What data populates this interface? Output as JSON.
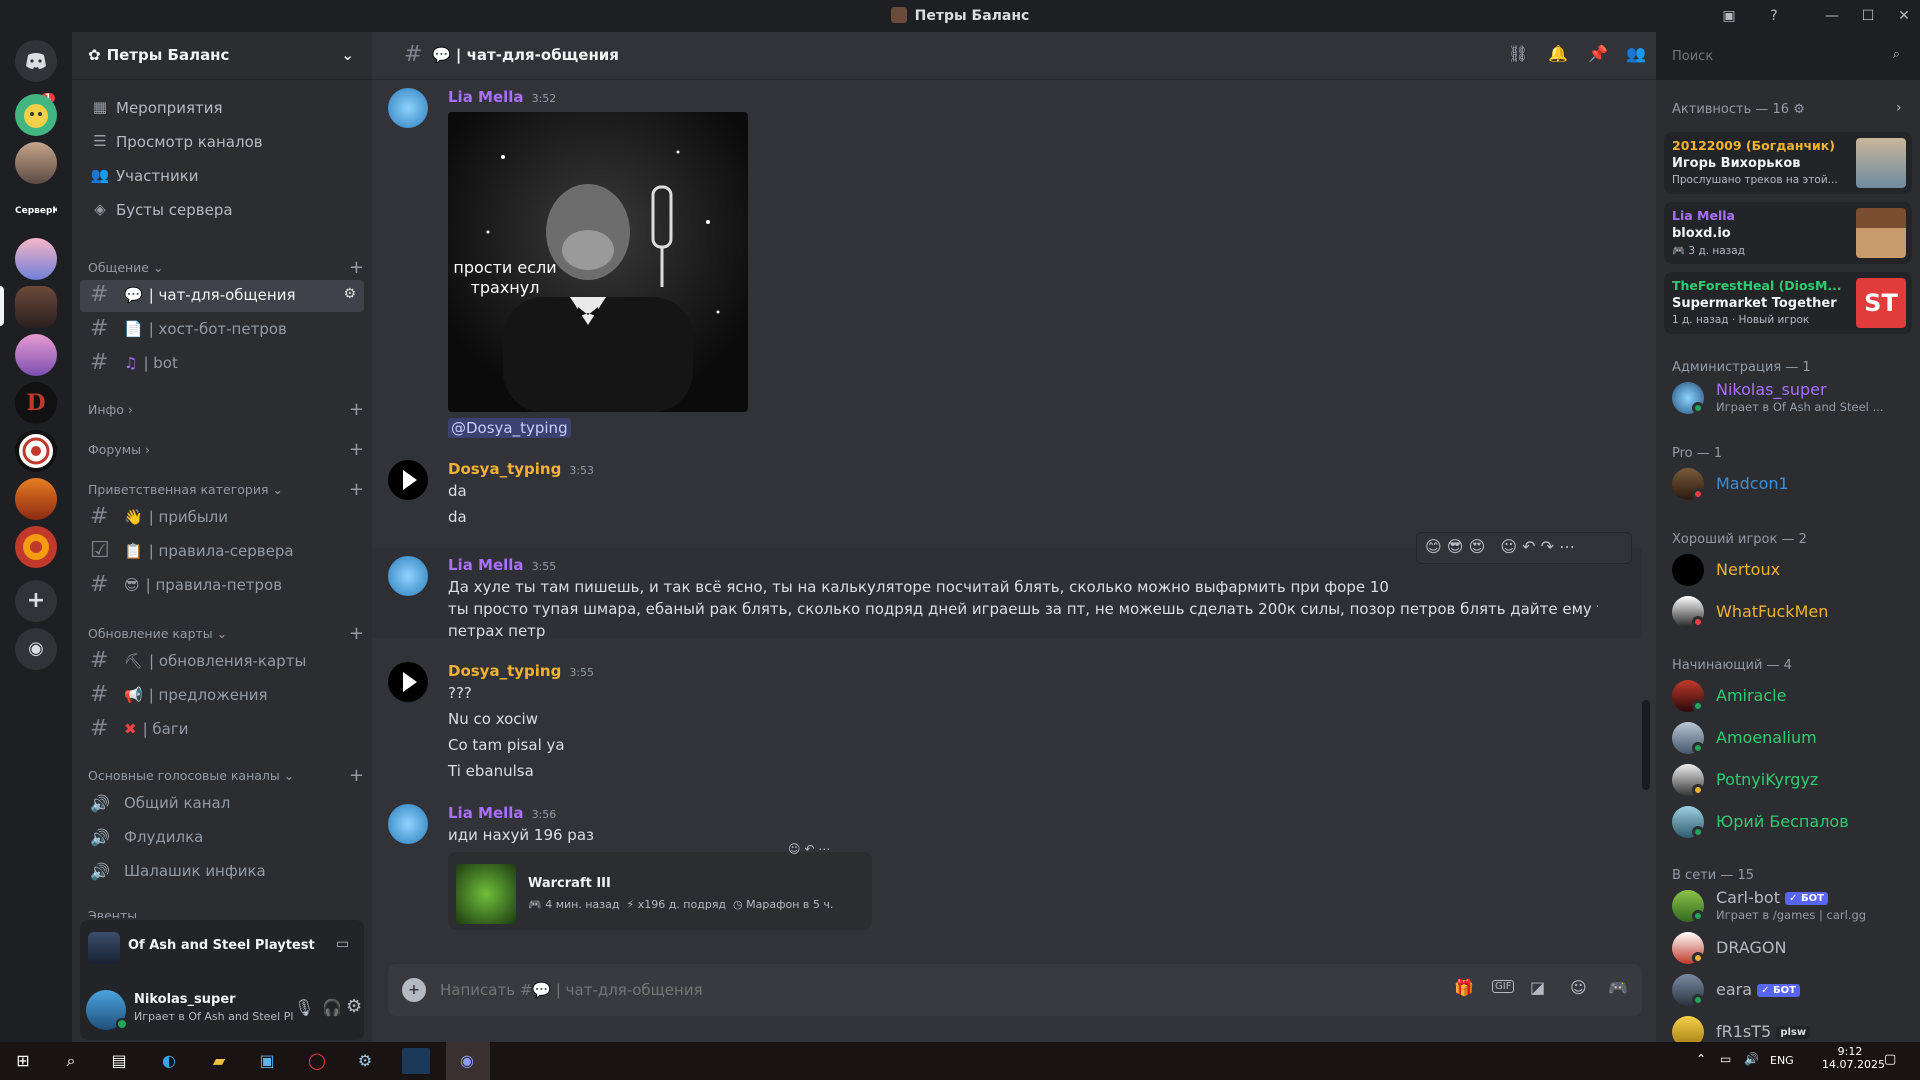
{
  "window": {
    "title": "Петры Баланс"
  },
  "guild": {
    "name": "Петры Баланс",
    "nav": [
      "Мероприятия",
      "Просмотр каналов",
      "Участники",
      "Бусты сервера"
    ],
    "categories": {
      "c1": "Общение",
      "c2": "Инфо",
      "c3": "Форумы",
      "c4": "Приветственная категория",
      "c5": "Обновление карты",
      "c6": "Основные голосовые каналы",
      "c7": "Эвенты"
    },
    "channels": {
      "chat": "| чат-для-общения",
      "host": "| хост-бот-петров",
      "bot": "| bot",
      "pribyli": "| прибыли",
      "rules_server": "| правила-сервера",
      "rules_petr": "| правила-петров",
      "map_updates": "| обновления-карты",
      "suggestions": "| предложения",
      "bugs": "| баги"
    },
    "voice": [
      "Общий канал",
      "Флудилка",
      "Шалашик инфика"
    ],
    "server_badge": "1",
    "server_label": "СерверК"
  },
  "activity_card": {
    "title": "Of Ash and Steel Playtest"
  },
  "user_panel": {
    "name": "Nikolas_super",
    "status": "Играет в Of Ash and Steel Pla..."
  },
  "chat_header": {
    "channel": "| чат-для-общения",
    "search_placeholder": "Поиск"
  },
  "messages": {
    "m1": {
      "author": "Lia Mella",
      "time": "3:52",
      "image_caption_l1": "прости если",
      "image_caption_l2": "трахнул",
      "mention": "@Dosya_typing"
    },
    "m2": {
      "author": "Dosya_typing",
      "time": "3:53",
      "l1": "da",
      "l2": "da"
    },
    "m3": {
      "author": "Lia Mella",
      "time": "3:55",
      "l1": "Да хуле ты там пишешь, и так всё ясно, ты на калькуляторе посчитай блять, сколько можно выфармить при форе 10",
      "l2": "ты просто тупая шмара, ебаный рак блять, сколько подряд дней играешь за пт, не можешь сделать 200к силы, позор петров блять дайте ему тег нахуй позорный в",
      "l3": "петрах петр"
    },
    "m4": {
      "author": "Dosya_typing",
      "time": "3:55",
      "l1": "???",
      "l2": "Nu co xociw",
      "l3": "Co tam pisal ya",
      "l4": "Ti ebanulsa"
    },
    "m5": {
      "author": "Lia Mella",
      "time": "3:56",
      "l1": "иди нахуй 196 раз",
      "embed_title": "Warcraft III",
      "embed_a": "4 мин. назад",
      "embed_b": "x196 д. подряд",
      "embed_c": "Марафон в 5 ч."
    }
  },
  "composer": {
    "placeholder": "Написать #💬 | чат-для-общения"
  },
  "members": {
    "activity_header": "Активность — 16",
    "activities": [
      {
        "user": "20122009 (Богданчик)",
        "title": "Игорь Вихорьков",
        "sub": "Прослушано треков на этой...",
        "color": "#f0b232"
      },
      {
        "user": "Lia Mella",
        "title": "bloxd.io",
        "sub": "3 д. назад",
        "color": "#a970ff"
      },
      {
        "user": "TheForestHeal (DiosM...",
        "title": "Supermarket Together",
        "sub": "1 д. назад",
        "sub2": "Новый игрок",
        "color": "#2ecc71"
      }
    ],
    "groups": {
      "admin": "Администрация — 1",
      "pro": "Pro — 1",
      "good": "Хороший игрок — 2",
      "beginner": "Начинающий — 4",
      "online": "В сети — 15"
    },
    "list": {
      "nikolas": {
        "name": "Nikolas_super",
        "sub": "Играет в Of Ash and Steel ...",
        "color": "#a970ff"
      },
      "madcon": {
        "name": "Madcon1",
        "color": "#3b8fd8"
      },
      "nertoux": {
        "name": "Nertoux",
        "color": "#f0b232"
      },
      "wfm": {
        "name": "WhatFuckMen",
        "color": "#f0b232"
      },
      "amiracle": {
        "name": "Amiracle",
        "color": "#2ecc71"
      },
      "amoenalium": {
        "name": "Amoenalium",
        "color": "#2ecc71"
      },
      "potnyi": {
        "name": "PotnyiKyrgyz",
        "color": "#2ecc71"
      },
      "yuriy": {
        "name": "Юрий Беспалов",
        "color": "#2ecc71"
      },
      "carl": {
        "name": "Carl-bot",
        "sub": "Играет в /games | carl.gg",
        "badge": "✓ БОТ",
        "color": "#b5bac1"
      },
      "dragon": {
        "name": "DRAGON",
        "color": "#b5bac1"
      },
      "eara": {
        "name": "eara",
        "badge": "✓ БОТ",
        "color": "#b5bac1"
      },
      "fr1st5": {
        "name": "fR1sT5",
        "badge": "plsw",
        "color": "#b5bac1"
      }
    }
  },
  "taskbar": {
    "lang": "ENG",
    "time": "9:12",
    "date": "14.07.2025"
  }
}
